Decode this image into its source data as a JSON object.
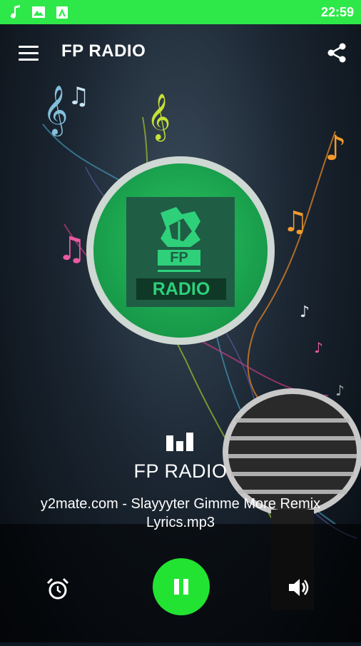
{
  "status_bar": {
    "time": "22:59",
    "icons": [
      "music-note-icon",
      "image-icon",
      "android-icon"
    ]
  },
  "app_bar": {
    "title": "FP RADIO",
    "menu_icon": "menu-icon",
    "share_icon": "share-icon"
  },
  "logo": {
    "fp_text": "FP",
    "radio_text": "RADIO"
  },
  "player": {
    "visualizer_icon": "equalizer-icon",
    "station_name": "FP RADIO",
    "track_title": "y2mate.com - Slayyyter  Gimme More Remix Lyrics.mp3"
  },
  "controls": {
    "alarm_icon": "alarm-icon",
    "play_pause_icon": "pause-icon",
    "volume_icon": "volume-icon"
  },
  "colors": {
    "accent": "#22e332",
    "status_bar": "#2ee84a",
    "logo_green": "#1aa04d"
  }
}
